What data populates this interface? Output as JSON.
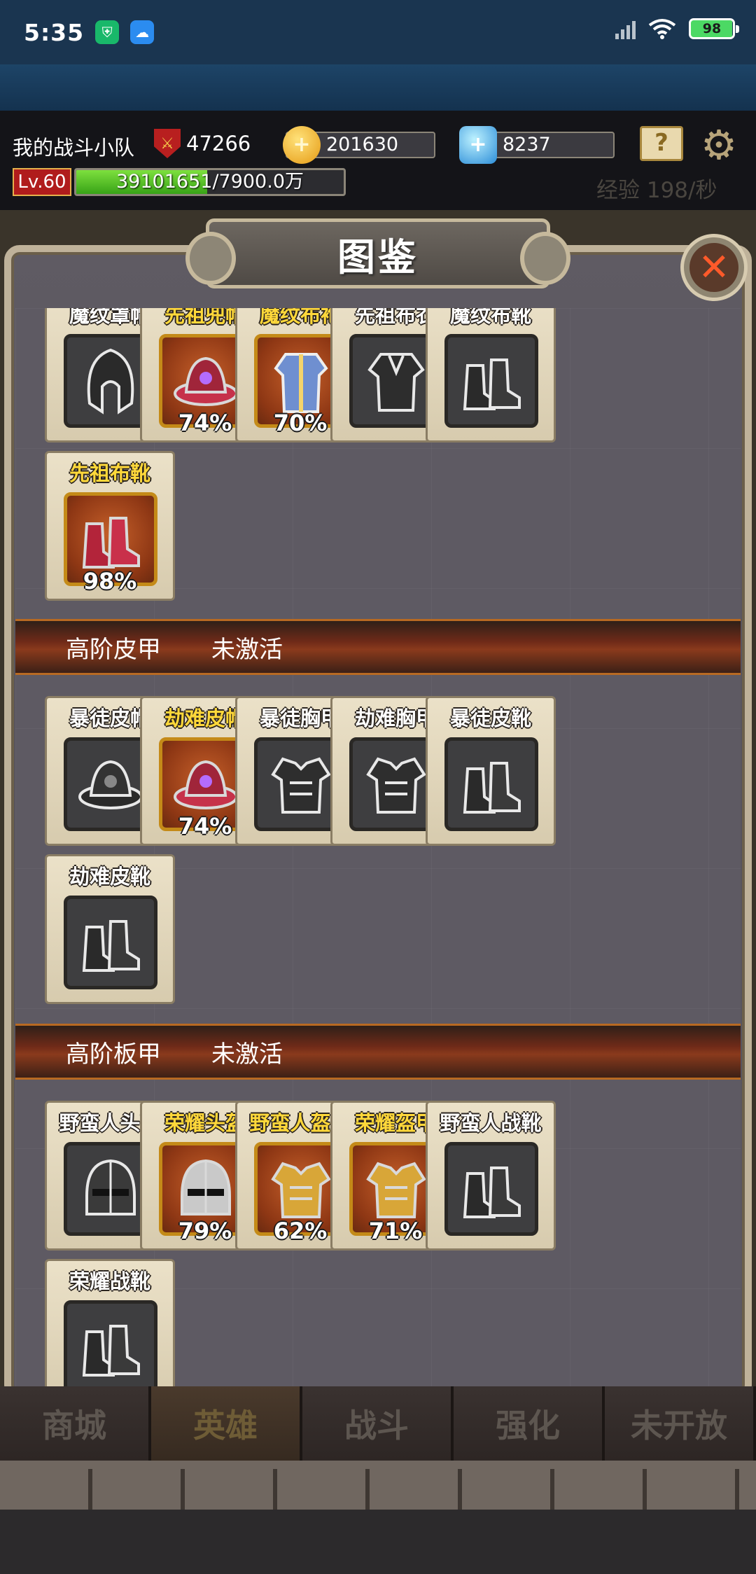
{
  "status_bar": {
    "time": "5:35",
    "battery_level": "98"
  },
  "header": {
    "team_name": "我的战斗小队",
    "power": "47266",
    "gold": "201630",
    "gems": "8237",
    "level": "Lv.60",
    "exp_text": "39101651/7900.0万",
    "exp_fraction": 0.49,
    "exp_rate": "经验 198/秒"
  },
  "panel": {
    "title": "图鉴",
    "rows": [
      {
        "items": [
          {
            "name": "魔纹罩帽",
            "tier": "normal",
            "icon": "hood-icon"
          },
          {
            "name": "先祖兜帽",
            "tier": "gold",
            "icon": "hat-icon",
            "progress": "74%"
          },
          {
            "name": "魔纹布袍",
            "tier": "gold",
            "icon": "robe-icon",
            "progress": "70%"
          },
          {
            "name": "先祖布衣",
            "tier": "normal",
            "icon": "cloth-icon"
          },
          {
            "name": "魔纹布靴",
            "tier": "normal",
            "icon": "boots-icon"
          }
        ]
      },
      {
        "items": [
          {
            "name": "先祖布靴",
            "tier": "gold",
            "icon": "boots-icon",
            "progress": "98%"
          }
        ]
      }
    ],
    "categories": [
      {
        "name": "高阶皮甲",
        "status": "未激活",
        "items": [
          {
            "name": "暴徒皮帽",
            "tier": "normal",
            "icon": "hat-icon"
          },
          {
            "name": "劫难皮帽",
            "tier": "gold",
            "icon": "hat-icon",
            "progress": "74%"
          },
          {
            "name": "暴徒胸甲",
            "tier": "normal",
            "icon": "chest-armor-icon"
          },
          {
            "name": "劫难胸甲",
            "tier": "normal",
            "icon": "chest-armor-icon"
          },
          {
            "name": "暴徒皮靴",
            "tier": "normal",
            "icon": "boots-icon"
          },
          {
            "name": "劫难皮靴",
            "tier": "normal",
            "icon": "boots-icon"
          }
        ]
      },
      {
        "name": "高阶板甲",
        "status": "未激活",
        "items": [
          {
            "name": "野蛮人头盔",
            "tier": "normal",
            "icon": "helmet-icon"
          },
          {
            "name": "荣耀头盔",
            "tier": "gold",
            "icon": "helmet-icon",
            "progress": "79%"
          },
          {
            "name": "野蛮人盔甲",
            "tier": "gold",
            "icon": "chest-armor-icon",
            "progress": "62%"
          },
          {
            "name": "荣耀盔甲",
            "tier": "gold",
            "icon": "chest-armor-icon",
            "progress": "71%"
          },
          {
            "name": "野蛮人战靴",
            "tier": "normal",
            "icon": "boots-icon"
          },
          {
            "name": "荣耀战靴",
            "tier": "normal",
            "icon": "boots-icon"
          }
        ]
      }
    ]
  },
  "bottom_nav": {
    "tabs": [
      {
        "label": "商城"
      },
      {
        "label": "英雄",
        "active": true
      },
      {
        "label": "战斗"
      },
      {
        "label": "强化"
      },
      {
        "label": "未开放"
      }
    ]
  }
}
